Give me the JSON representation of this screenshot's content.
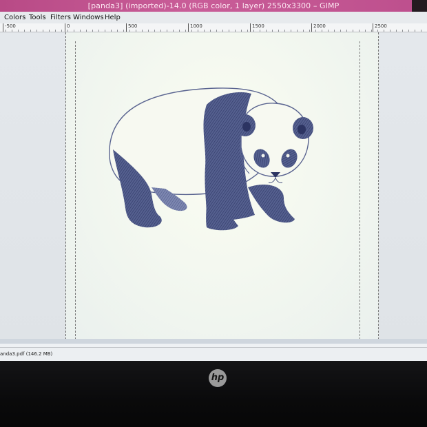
{
  "window": {
    "title": "[panda3] (imported)-14.0 (RGB color, 1 layer) 2550x3300 – GIMP"
  },
  "menubar": {
    "items": [
      "Colors",
      "Tools",
      "Filters",
      "Windows",
      "Help"
    ]
  },
  "ruler": {
    "ticks": [
      "-500",
      "0",
      "500",
      "1000",
      "1500",
      "2000",
      "2500"
    ]
  },
  "statusbar": {
    "text": "anda3.pdf (146.2 MB)"
  },
  "bezel": {
    "logo": "hp"
  },
  "colors": {
    "titlebar": "#c0538f",
    "canvas": "#f6f9ef",
    "ink": "#3b4676"
  },
  "icons": [
    "window-controls-icon",
    "hp-logo-icon"
  ]
}
